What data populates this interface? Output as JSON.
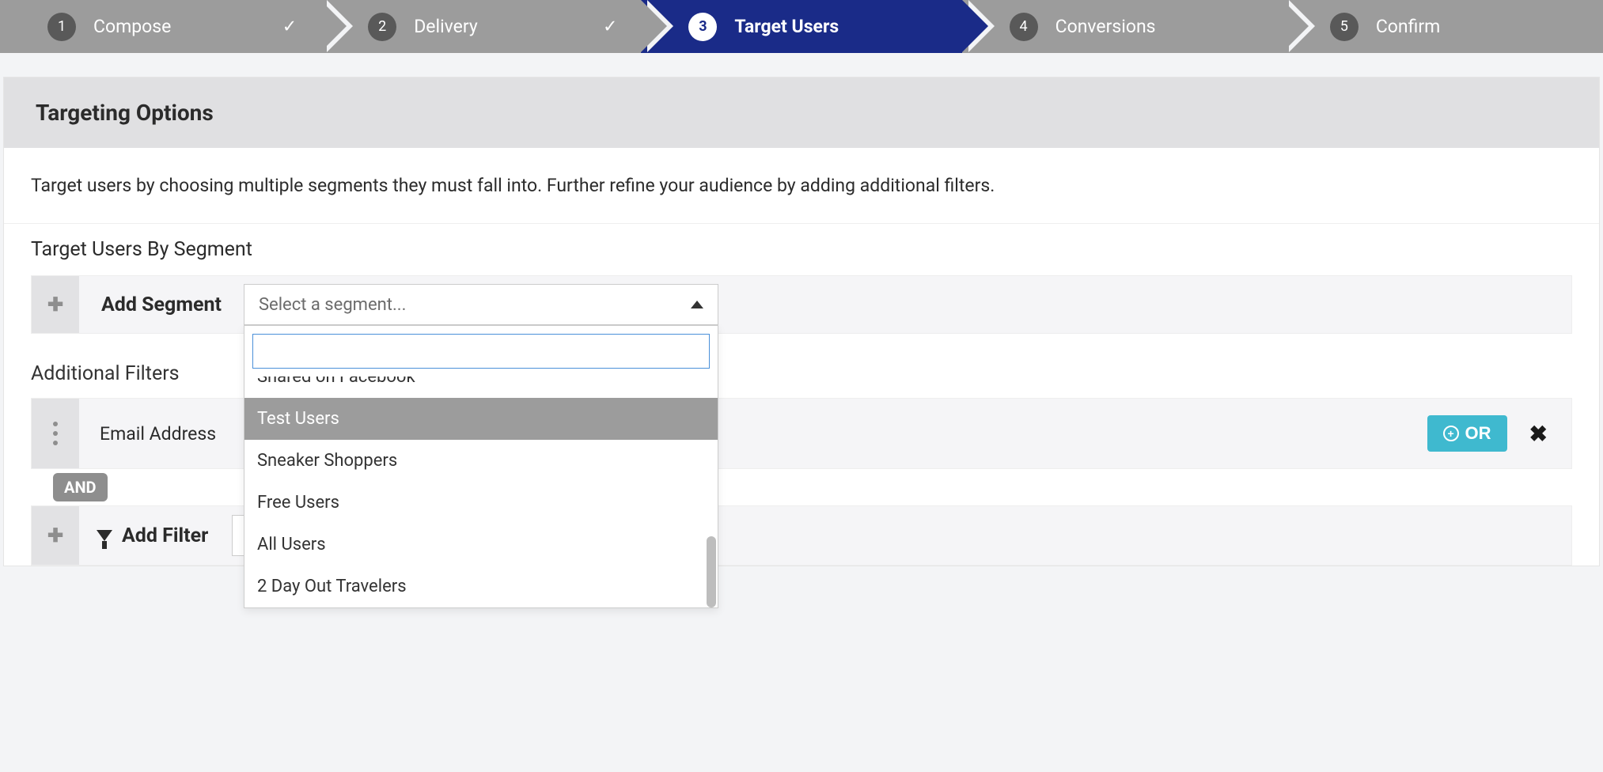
{
  "stepper": {
    "steps": [
      {
        "num": "1",
        "label": "Compose",
        "done": true
      },
      {
        "num": "2",
        "label": "Delivery",
        "done": true
      },
      {
        "num": "3",
        "label": "Target Users",
        "active": true
      },
      {
        "num": "4",
        "label": "Conversions"
      },
      {
        "num": "5",
        "label": "Confirm"
      }
    ]
  },
  "panel": {
    "title": "Targeting Options",
    "desc": "Target users by choosing multiple segments they must fall into. Further refine your audience by adding additional filters."
  },
  "segments": {
    "section_title": "Target Users By Segment",
    "add_label": "Add Segment",
    "select_placeholder": "Select a segment...",
    "dropdown_options": [
      {
        "label": "Shared on Facebook",
        "cut": true
      },
      {
        "label": "Test Users",
        "highlight": true
      },
      {
        "label": "Sneaker Shoppers"
      },
      {
        "label": "Free Users"
      },
      {
        "label": "All Users"
      },
      {
        "label": "2 Day Out Travelers"
      }
    ]
  },
  "filters": {
    "section_title": "Additional Filters",
    "filter_label": "Email Address",
    "or_label": "OR",
    "and_label": "AND",
    "add_filter_label": "Add Filter",
    "add_filter_value_visible": "S"
  }
}
